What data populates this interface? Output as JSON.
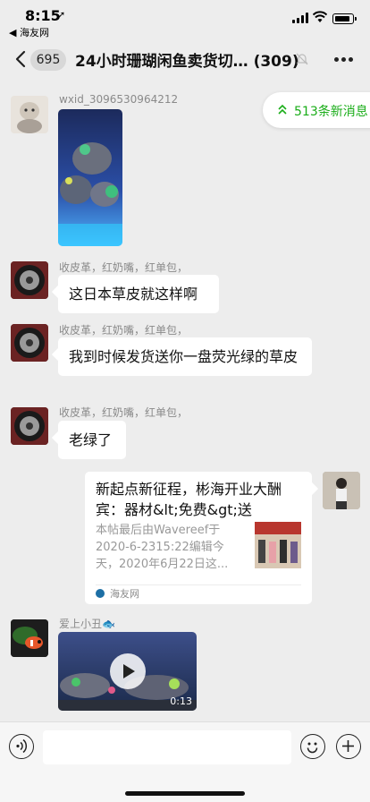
{
  "status_bar": {
    "time": "8:15",
    "return_app": "◀ 海友网"
  },
  "nav": {
    "unread_count": "695",
    "title": "24小时珊瑚闲鱼卖货切… (309)"
  },
  "new_messages_label": "513条新消息",
  "messages": [
    {
      "sender": "wxid_3096530964212",
      "type": "image"
    },
    {
      "sender": "收皮革，红奶嘴，红单包，",
      "text": "这日本草皮就这样啊"
    },
    {
      "sender": "收皮革，红奶嘴，红单包，",
      "text": "我到时候发货送你一盘荧光绿的草皮"
    },
    {
      "sender": "收皮革，红奶嘴，红单包，",
      "text": "老绿了"
    },
    {
      "type": "link",
      "title": "新起点新征程，彬海开业大酬宾：器材&lt;免费&gt;送",
      "description": "本帖最后由Wavereef于2020-6-2315:22编辑今天，2020年6月22日这...",
      "source": "海友网"
    },
    {
      "sender": "爱上小丑🐟",
      "type": "video",
      "duration": "0:13"
    }
  ],
  "colors": {
    "background": "#ededed",
    "accent_green": "#1aad19",
    "bubble": "#ffffff"
  }
}
